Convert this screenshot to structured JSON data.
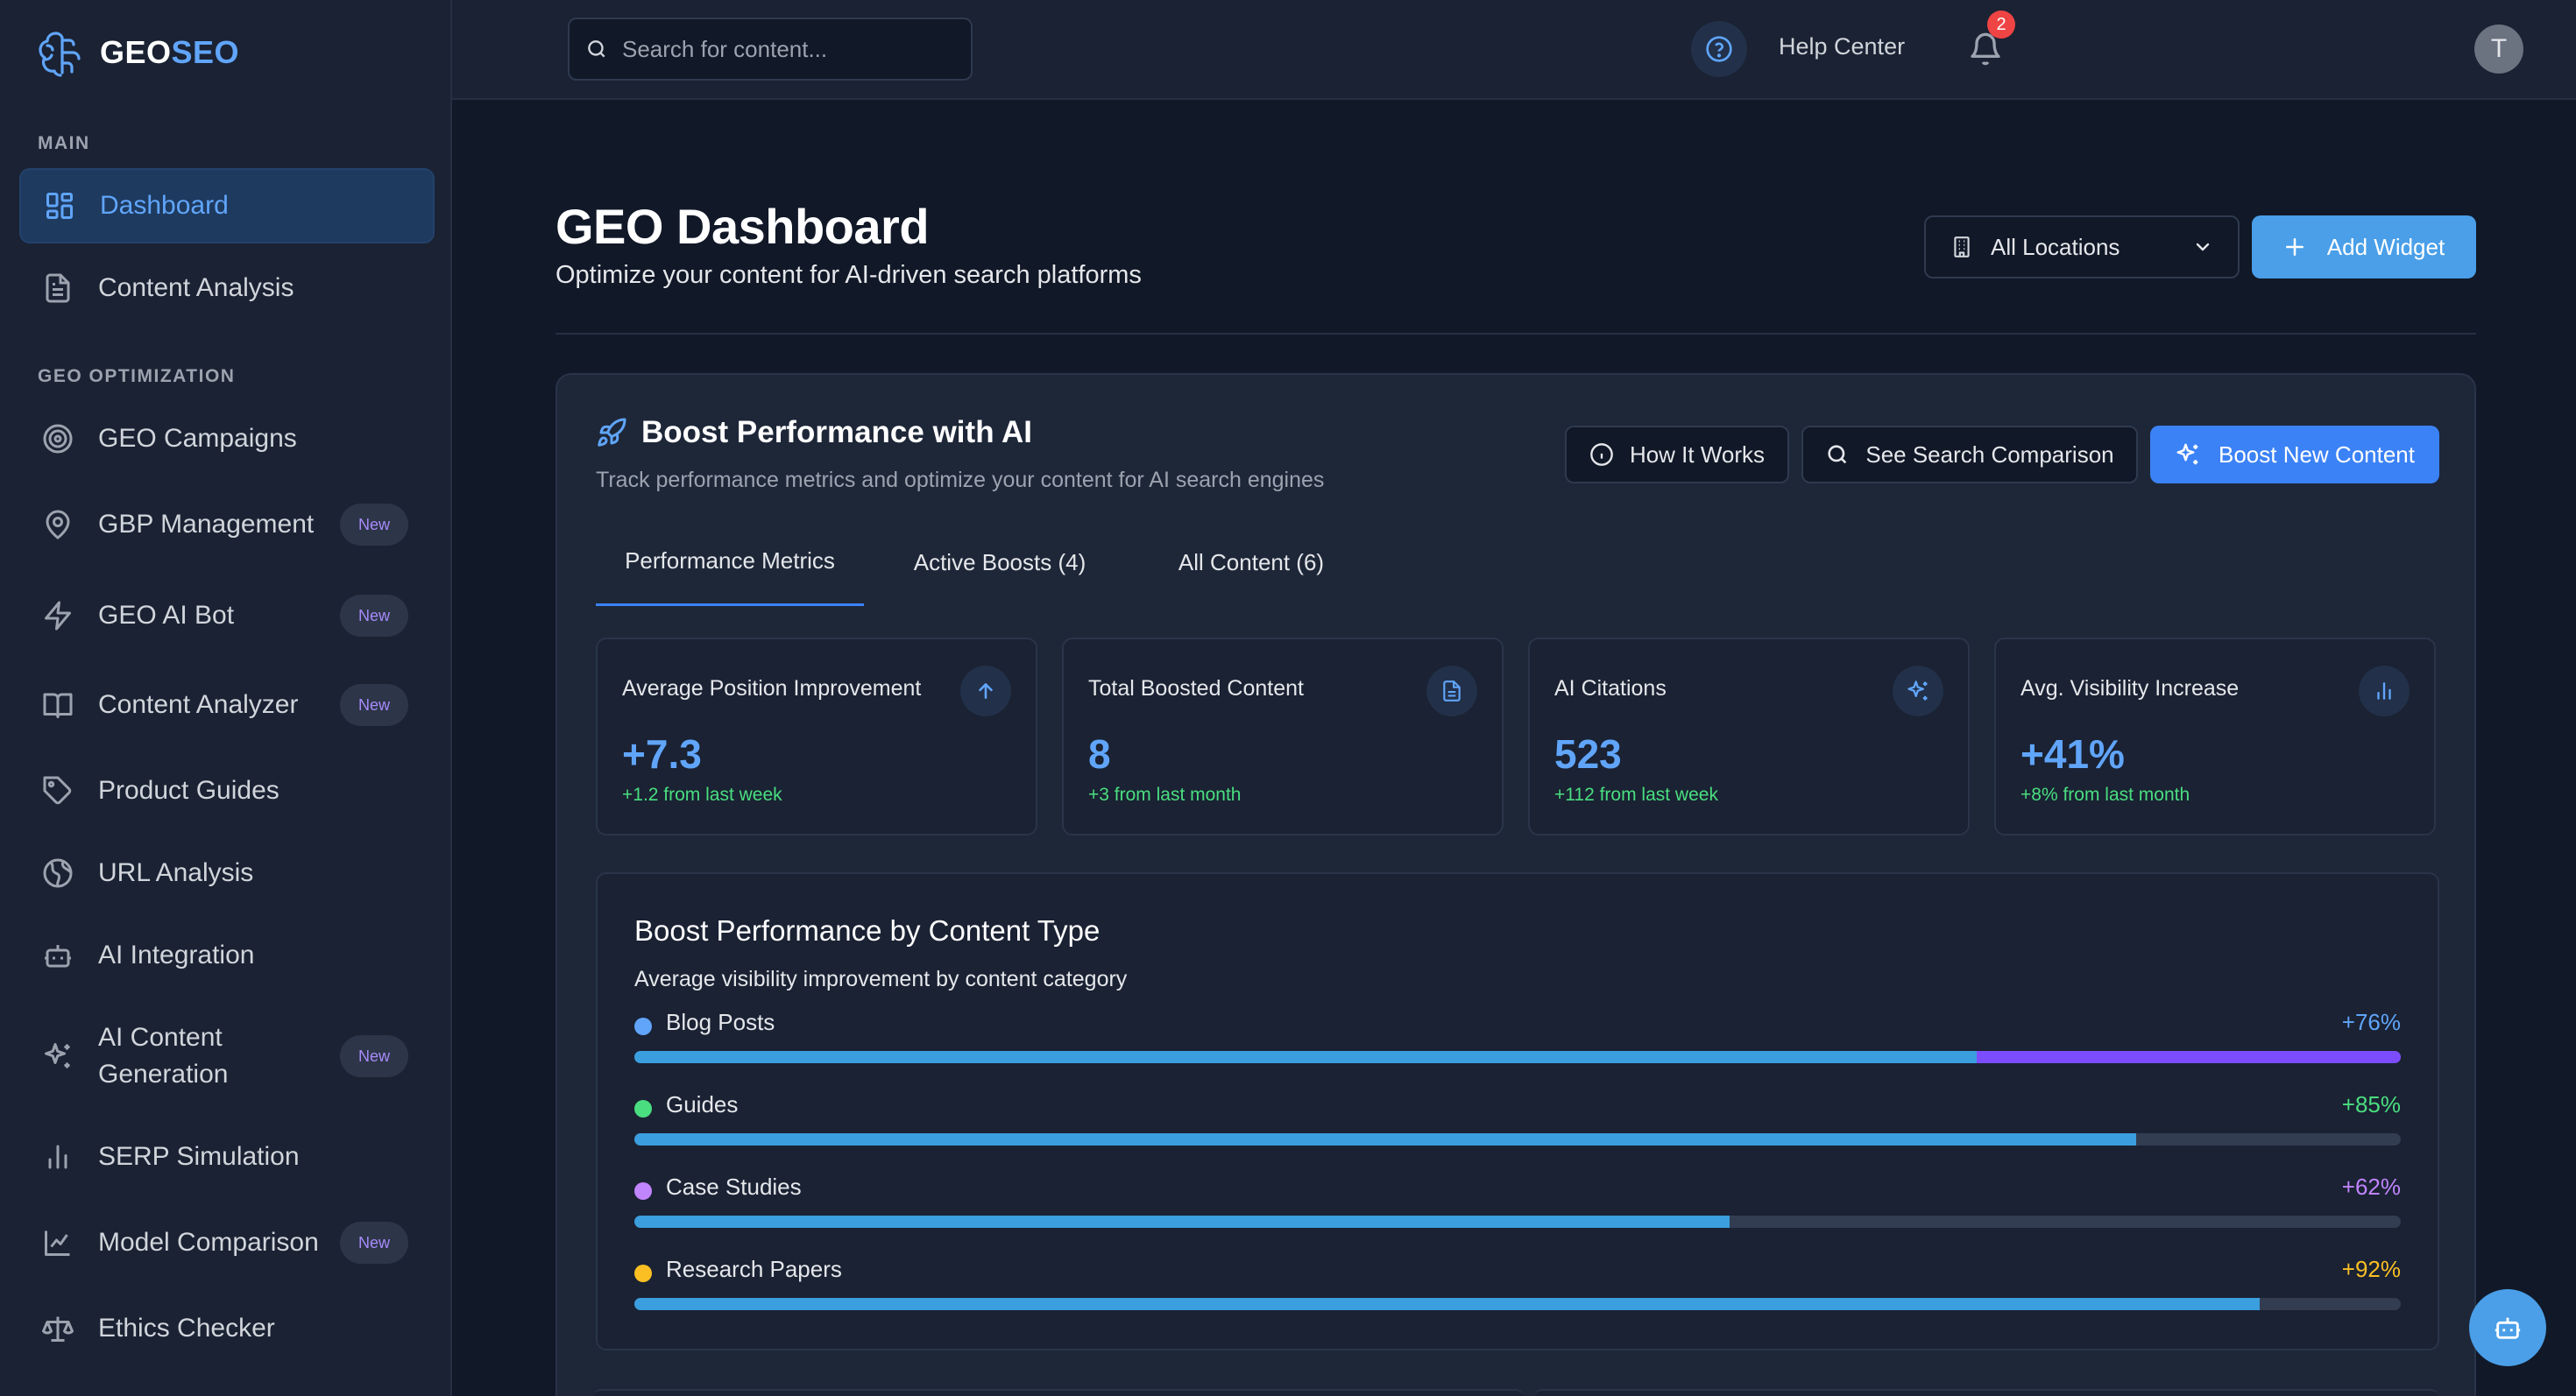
{
  "brand": {
    "name_part1": "GEO",
    "name_part2": "SEO"
  },
  "sidebar": {
    "section_main": "MAIN",
    "section_geo": "GEO OPTIMIZATION",
    "items": [
      {
        "label": "Dashboard",
        "icon": "dashboard-icon",
        "active": true
      },
      {
        "label": "Content Analysis",
        "icon": "document-icon"
      },
      {
        "label": "GEO Campaigns",
        "icon": "target-icon"
      },
      {
        "label": "GBP Management",
        "icon": "map-pin-icon",
        "badge": "New"
      },
      {
        "label": "GEO AI Bot",
        "icon": "lightning-icon",
        "badge": "New"
      },
      {
        "label": "Content Analyzer",
        "icon": "book-icon",
        "badge": "New"
      },
      {
        "label": "Product Guides",
        "icon": "tag-icon"
      },
      {
        "label": "URL Analysis",
        "icon": "globe-icon"
      },
      {
        "label": "AI Integration",
        "icon": "robot-icon"
      },
      {
        "label": "AI Content Generation",
        "icon": "sparkles-icon",
        "badge": "New"
      },
      {
        "label": "SERP Simulation",
        "icon": "bar-chart-icon"
      },
      {
        "label": "Model Comparison",
        "icon": "line-chart-icon",
        "badge": "New"
      },
      {
        "label": "Ethics Checker",
        "icon": "scale-icon"
      }
    ]
  },
  "topbar": {
    "search_placeholder": "Search for content...",
    "help_label": "Help Center",
    "notification_count": "2",
    "avatar_initial": "T"
  },
  "header": {
    "title": "GEO Dashboard",
    "subtitle": "Optimize your content for AI-driven search platforms",
    "location_select": "All Locations",
    "add_widget": "Add Widget"
  },
  "panel": {
    "title": "Boost Performance with AI",
    "subtitle": "Track performance metrics and optimize your content for AI search engines",
    "buttons": {
      "how_it_works": "How It Works",
      "search_comparison": "See Search Comparison",
      "boost_new": "Boost New Content"
    },
    "tabs": [
      {
        "label": "Performance Metrics",
        "active": true
      },
      {
        "label": "Active Boosts (4)"
      },
      {
        "label": "All Content (6)"
      }
    ],
    "metrics": [
      {
        "label": "Average Position Improvement",
        "value": "+7.3",
        "delta": "+1.2 from last week",
        "icon": "arrow-up-icon"
      },
      {
        "label": "Total Boosted Content",
        "value": "8",
        "delta": "+3 from last month",
        "icon": "document-icon"
      },
      {
        "label": "AI Citations",
        "value": "523",
        "delta": "+112 from last week",
        "icon": "sparkles-icon"
      },
      {
        "label": "Avg. Visibility Increase",
        "value": "+41%",
        "delta": "+8% from last month",
        "icon": "bar-chart-icon"
      }
    ],
    "content_type": {
      "title": "Boost Performance by Content Type",
      "subtitle": "Average visibility improvement by content category",
      "rows": [
        {
          "label": "Blog Posts",
          "value": "+76%",
          "color": "#60a5fa",
          "value_color": "#60a5fa",
          "fill_fraction": 0.76,
          "fill2_fraction": 0.24
        },
        {
          "label": "Guides",
          "value": "+85%",
          "color": "#4ade80",
          "value_color": "#4ade80",
          "fill_fraction": 0.85
        },
        {
          "label": "Case Studies",
          "value": "+62%",
          "color": "#c084fc",
          "value_color": "#c084fc",
          "fill_fraction": 0.62
        },
        {
          "label": "Research Papers",
          "value": "+92%",
          "color": "#fbbf24",
          "value_color": "#fbbf24",
          "fill_fraction": 0.92
        }
      ]
    }
  },
  "colors": {
    "accent": "#3b82f6",
    "success": "#4ade80",
    "badge_text": "#a78bfa"
  }
}
